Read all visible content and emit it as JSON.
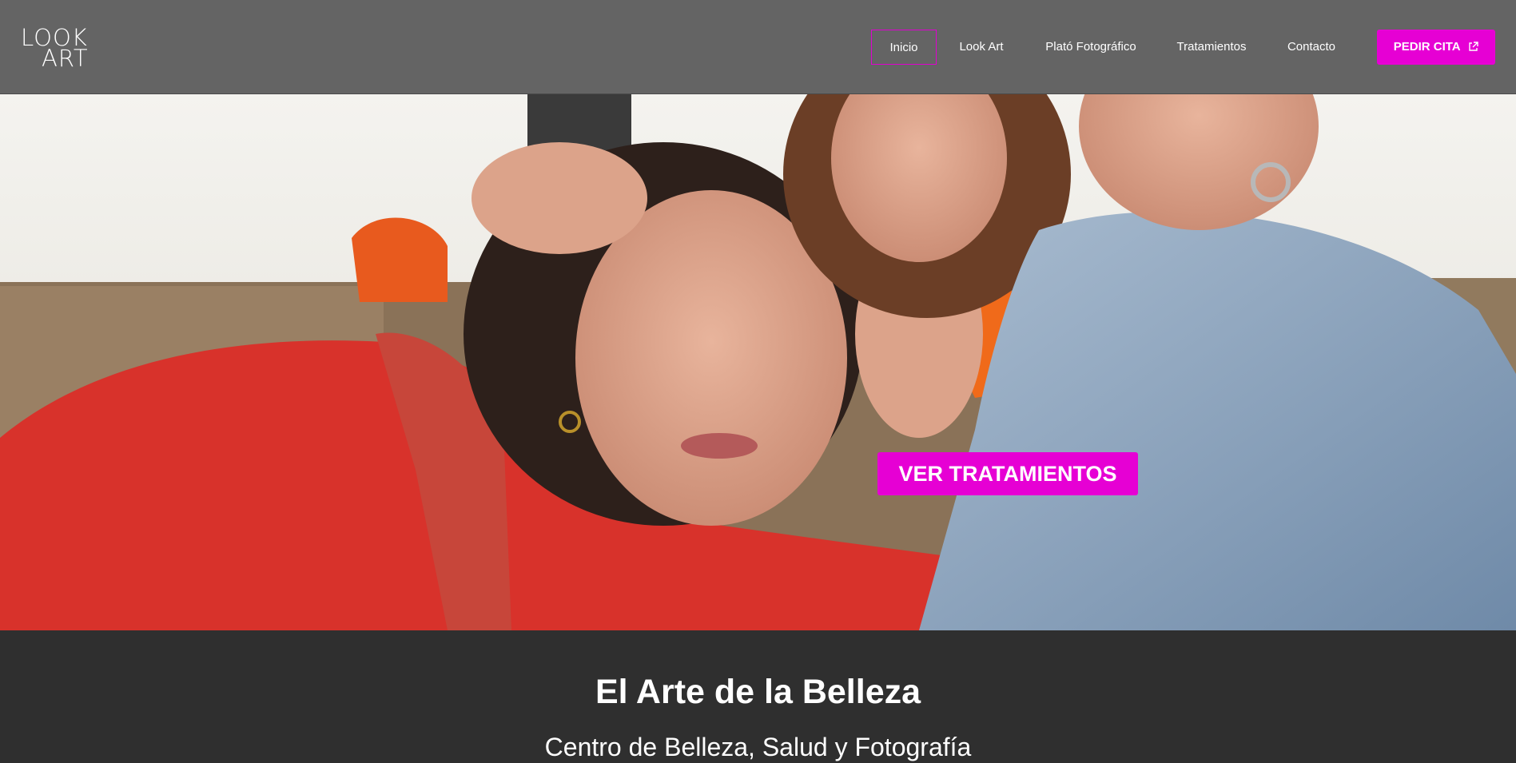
{
  "header": {
    "logo": {
      "line1": "LOOK",
      "line2": "ART"
    },
    "nav": [
      {
        "label": "Inicio",
        "active": true
      },
      {
        "label": "Look Art",
        "active": false
      },
      {
        "label": "Plató Fotográfico",
        "active": false
      },
      {
        "label": "Tratamientos",
        "active": false
      },
      {
        "label": "Contacto",
        "active": false
      }
    ],
    "cta_label": "PEDIR CITA",
    "cta_icon": "external-link-icon"
  },
  "hero": {
    "button_label": "VER TRATAMIENTOS",
    "image_description_icon": "hero-photo"
  },
  "intro": {
    "title": "El Arte de la Belleza",
    "subtitle": "Centro de Belleza, Salud y Fotografía"
  },
  "colors": {
    "header_bg": "#646464",
    "accent": "#e600d4",
    "page_bg": "#2f2f2f",
    "text": "#ffffff"
  }
}
